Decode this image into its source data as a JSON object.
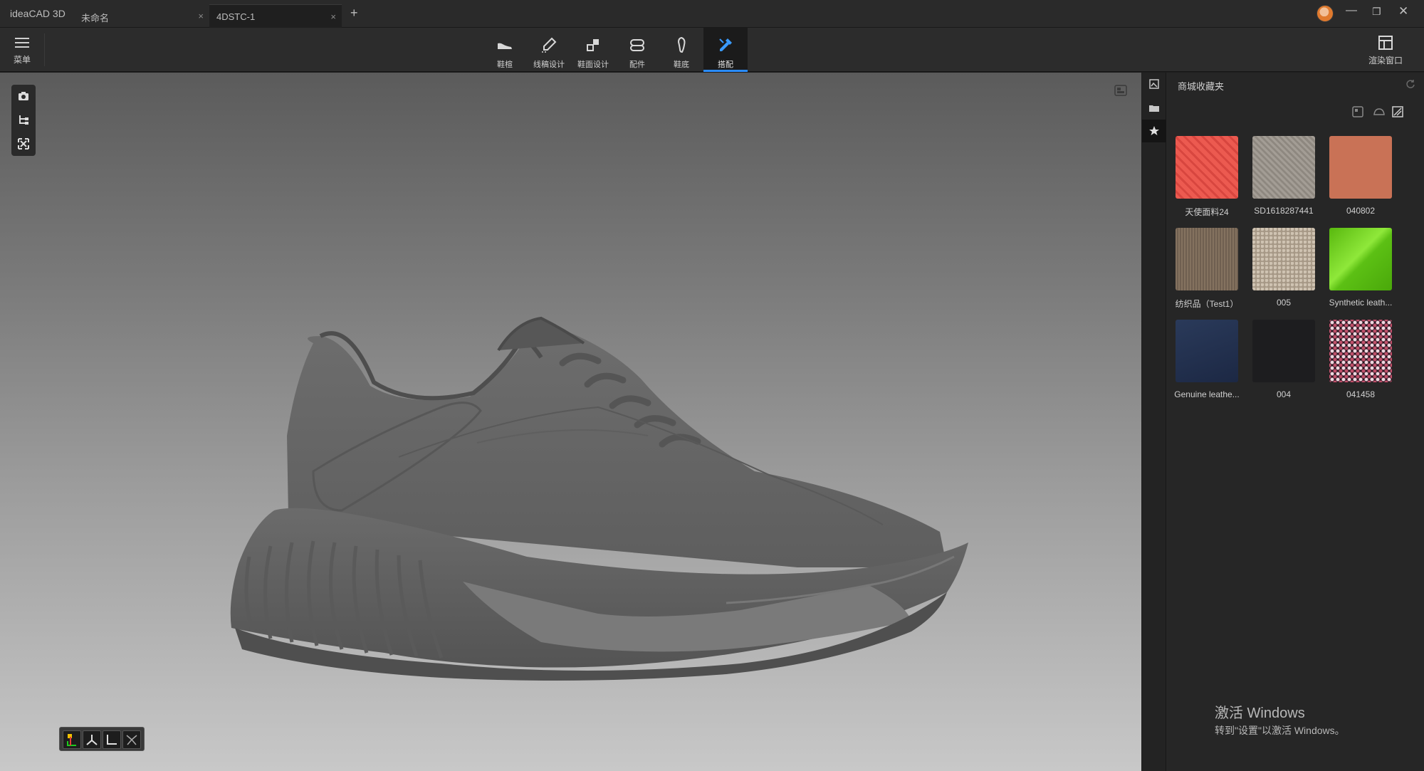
{
  "app": {
    "title": "ideaCAD 3D"
  },
  "tabs": [
    {
      "label": "未命名",
      "close": "×"
    },
    {
      "label": "4DSTC-1",
      "close": "×"
    }
  ],
  "tab_add": "+",
  "window_controls": {
    "minimize": "—",
    "restore": "❐",
    "close": "✕"
  },
  "toolbar": {
    "menu_label": "菜单",
    "tools": [
      {
        "label": "鞋楦",
        "icon": "shoe-last-icon"
      },
      {
        "label": "线稿设计",
        "icon": "pen-sketch-icon"
      },
      {
        "label": "鞋面设计",
        "icon": "upper-design-icon"
      },
      {
        "label": "配件",
        "icon": "accessory-icon"
      },
      {
        "label": "鞋底",
        "icon": "sole-icon"
      },
      {
        "label": "搭配",
        "icon": "match-paint-icon",
        "active": true
      }
    ],
    "render_window_label": "渲染窗口"
  },
  "panel": {
    "title": "商城收藏夹",
    "materials": [
      {
        "name": "天使面料24",
        "color": "#e8524a"
      },
      {
        "name": "SD1618287441",
        "color": "#9a948c"
      },
      {
        "name": "040802",
        "color": "#c97256"
      },
      {
        "name": "纺织品（Test1）",
        "color": "#7d6c5c"
      },
      {
        "name": "005",
        "color": "#b3a695"
      },
      {
        "name": "Synthetic leath...",
        "color": "#6acc18"
      },
      {
        "name": "Genuine leathe...",
        "color": "#243350"
      },
      {
        "name": "004",
        "color": "#1d1d1f"
      },
      {
        "name": "041458",
        "color": "#2a1420"
      }
    ]
  },
  "watermark": {
    "line1": "激活 Windows",
    "line2": "转到\"设置\"以激活 Windows。"
  },
  "colors": {
    "accent": "#2a8cff",
    "viewport_top": "#5b5b5b",
    "viewport_bottom": "#c8c8c8"
  }
}
